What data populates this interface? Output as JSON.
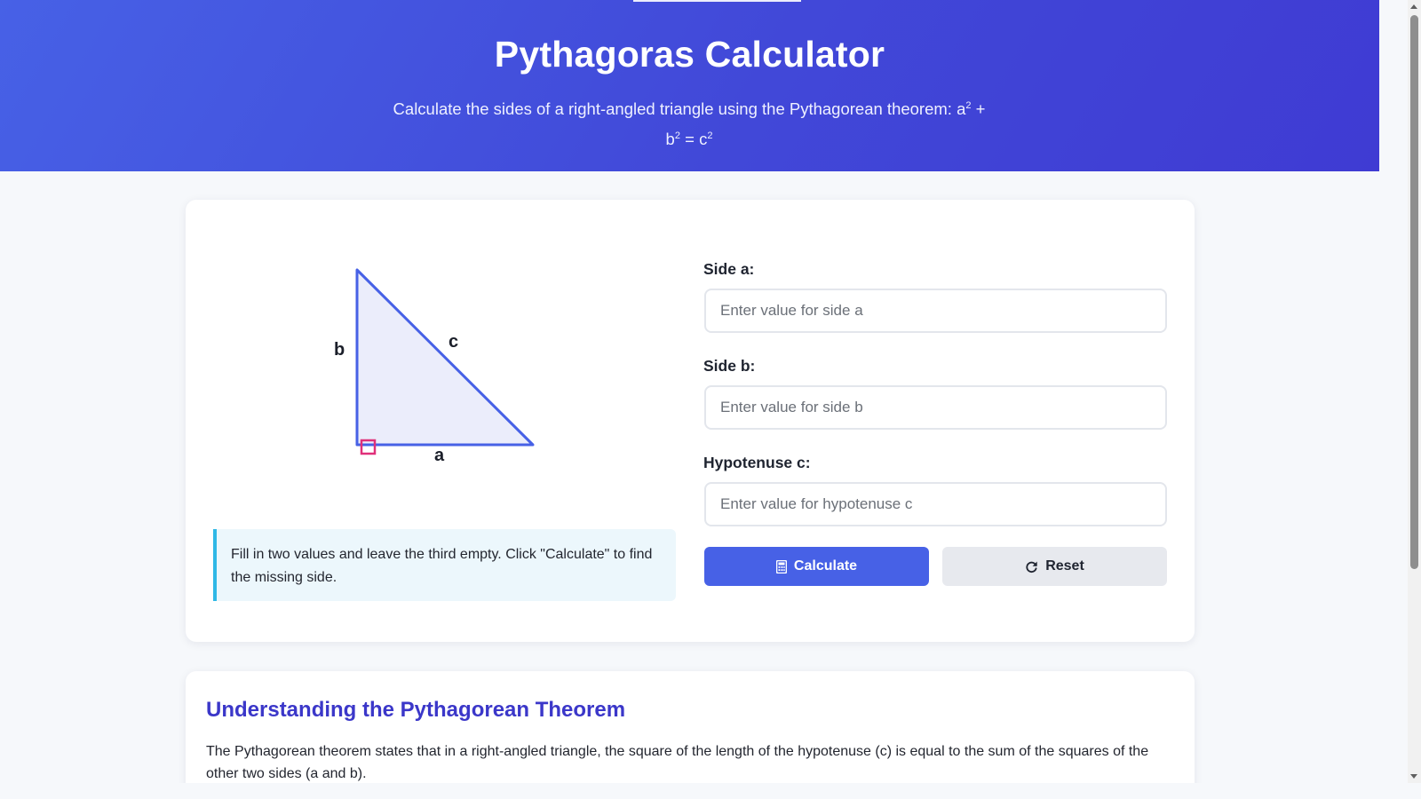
{
  "header": {
    "title": "Pythagoras Calculator",
    "subtitle_text": "Calculate the sides of a right-angled triangle using the Pythagorean theorem: ",
    "formula": {
      "a": "a",
      "b": "b",
      "c": "c",
      "exp": "2",
      "plus": "+",
      "equals": "="
    }
  },
  "diagram": {
    "side_a_label": "a",
    "side_b_label": "b",
    "side_c_label": "c",
    "fill_color": "#ebedfb",
    "stroke_color": "#4761e6",
    "right_angle_color": "#e0307a"
  },
  "hint": {
    "text": "Fill in two values and leave the third empty. Click \"Calculate\" to find the missing side."
  },
  "form": {
    "side_a": {
      "label": "Side a:",
      "placeholder": "Enter value for side a",
      "value": ""
    },
    "side_b": {
      "label": "Side b:",
      "placeholder": "Enter value for side b",
      "value": ""
    },
    "hypotenuse_c": {
      "label": "Hypotenuse c:",
      "placeholder": "Enter value for hypotenuse c",
      "value": ""
    },
    "calculate_label": "Calculate",
    "reset_label": "Reset",
    "calculate_icon": "calculator-icon",
    "reset_icon": "rotate-right-icon"
  },
  "info": {
    "title": "Understanding the Pythagorean Theorem",
    "text": "The Pythagorean theorem states that in a right-angled triangle, the square of the length of the hypotenuse (c) is equal to the sum of the squares of the other two sides (a and b)."
  },
  "colors": {
    "accent": "#4761e6",
    "heading": "#3b37c9",
    "hint_border": "#2fb8e6"
  }
}
